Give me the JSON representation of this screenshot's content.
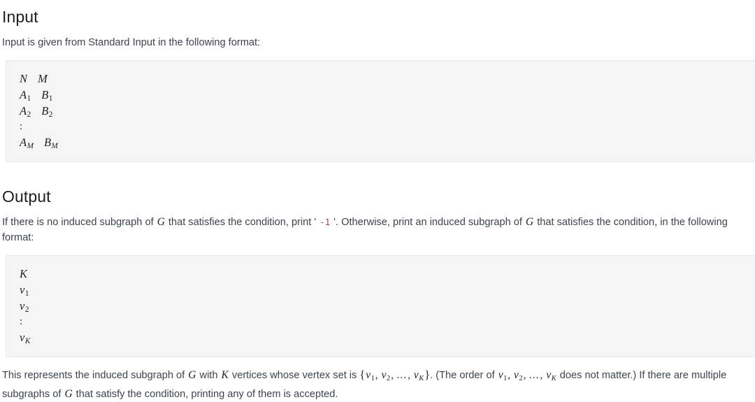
{
  "document": {
    "sections": [
      {
        "id": "input",
        "heading": "Input",
        "intro": "Input is given from Standard Input in the following format:",
        "format_block": {
          "lines": [
            {
              "type": "math",
              "tokens": [
                {
                  "t": "N"
                },
                {
                  "t": "M"
                }
              ]
            },
            {
              "type": "math",
              "tokens": [
                {
                  "t": "A",
                  "sub": "1"
                },
                {
                  "t": "B",
                  "sub": "1"
                }
              ]
            },
            {
              "type": "math",
              "tokens": [
                {
                  "t": "A",
                  "sub": "2"
                },
                {
                  "t": "B",
                  "sub": "2"
                }
              ]
            },
            {
              "type": "vdots",
              "text": ":"
            },
            {
              "type": "math",
              "tokens": [
                {
                  "t": "A",
                  "sub": "M"
                },
                {
                  "t": "B",
                  "sub": "M"
                }
              ]
            }
          ]
        }
      },
      {
        "id": "output",
        "heading": "Output",
        "format_block": {
          "lines": [
            {
              "type": "math",
              "tokens": [
                {
                  "t": "K"
                }
              ]
            },
            {
              "type": "math",
              "tokens": [
                {
                  "t": "v",
                  "sub": "1"
                }
              ]
            },
            {
              "type": "math",
              "tokens": [
                {
                  "t": "v",
                  "sub": "2"
                }
              ]
            },
            {
              "type": "vdots",
              "text": ":"
            },
            {
              "type": "math",
              "tokens": [
                {
                  "t": "v",
                  "sub": "K"
                }
              ]
            }
          ]
        }
      }
    ],
    "output_paragraph": {
      "p1_a": "If there is no induced subgraph of ",
      "p1_g": "G",
      "p1_b": " that satisfies the condition, print ",
      "p1_quote_open": "'",
      "p1_literal": "-1",
      "p1_quote_close": "'",
      "p1_c": ". Otherwise, print an induced subgraph of ",
      "p1_g2": "G",
      "p1_d": " that satisfies the condition, in the following format:"
    },
    "closing_paragraph": {
      "c_a": "This represents the induced subgraph of ",
      "c_g": "G",
      "c_b": " with ",
      "c_k": "K",
      "c_c": " vertices whose vertex set is ",
      "set_open": "{",
      "set_v1": "v",
      "set_v1_sub": "1",
      "set_comma1": ",",
      "set_v2": "v",
      "set_v2_sub": "2",
      "set_comma2": ",",
      "set_dots": "…",
      "set_comma3": ",",
      "set_vk": "v",
      "set_vk_sub": "K",
      "set_close": "}",
      "c_d": ". (The order of ",
      "o_v1": "v",
      "o_v1_sub": "1",
      "o_comma1": ",",
      "o_v2": "v",
      "o_v2_sub": "2",
      "o_comma2": ",",
      "o_dots": "…",
      "o_comma3": ",",
      "o_vk": "v",
      "o_vk_sub": "K",
      "c_e": " does not matter.) If there are multiple subgraphs of ",
      "c_g2": "G",
      "c_f": " that satisfy the condition, printing any of them is accepted."
    }
  },
  "theme": {
    "page_background": "#ffffff",
    "text_color": "#3b4351",
    "heading_color": "#1b1f23",
    "block_background": "#f5f5f5",
    "block_border": "#e8e8e8",
    "code_literal_color": "#bd4147",
    "math_color": "#222222"
  }
}
